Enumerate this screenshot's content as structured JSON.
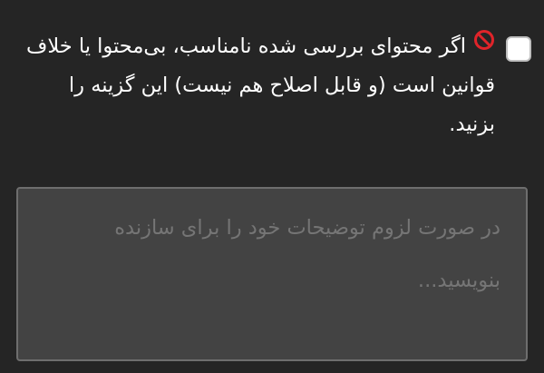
{
  "option": {
    "icon": "prohibited-icon",
    "icon_color": "#e0242a",
    "label": "اگر محتوای بررسی شده نامناسب، بی‌محتوا یا خلاف قوانین است (و قابل اصلاح هم نیست) این گزینه را بزنید.",
    "checked": false
  },
  "comment": {
    "value": "",
    "placeholder": "در صورت لزوم توضیحات خود را برای سازنده بنویسید..."
  },
  "colors": {
    "background": "#252525",
    "text": "#ffffff",
    "field_background": "#434343",
    "placeholder": "#a9a9a9"
  }
}
